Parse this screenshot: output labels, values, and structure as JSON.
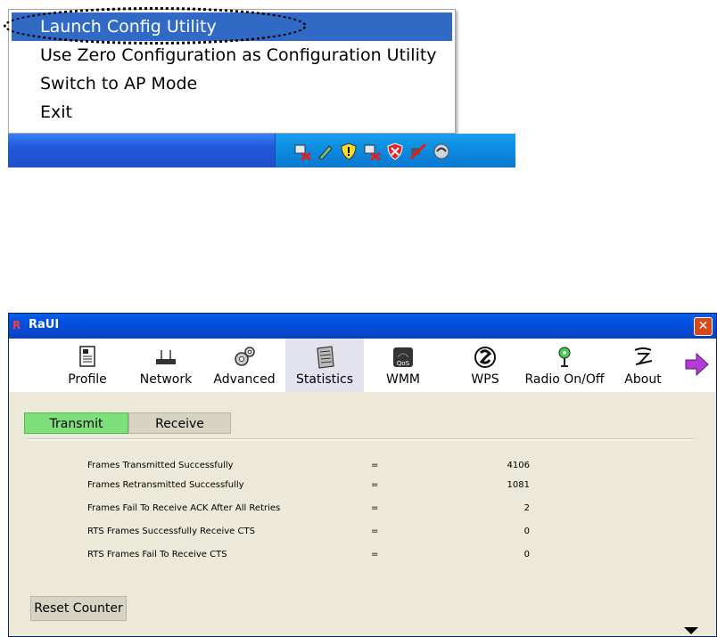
{
  "context_menu": {
    "items": [
      {
        "label": "Launch Config Utility"
      },
      {
        "label": "Use Zero Configuration as Configuration Utility"
      },
      {
        "label": "Switch to AP Mode"
      },
      {
        "label": "Exit"
      }
    ]
  },
  "tray": {
    "icons": [
      "network-disconnected-icon",
      "pen-icon",
      "security-shield-icon",
      "network-disconnected-icon",
      "alert-shield-icon",
      "wireless-disconnected-icon",
      "ralink-icon"
    ]
  },
  "window": {
    "title": "RaUI",
    "close_glyph": "✕",
    "toolbar": {
      "items": [
        {
          "label": "Profile",
          "icon": "profile-icon"
        },
        {
          "label": "Network",
          "icon": "router-icon"
        },
        {
          "label": "Advanced",
          "icon": "gears-icon"
        },
        {
          "label": "Statistics",
          "icon": "calculator-icon"
        },
        {
          "label": "WMM",
          "icon": "qos-icon"
        },
        {
          "label": "WPS",
          "icon": "wps-icon"
        },
        {
          "label": "Radio On/Off",
          "icon": "radio-icon"
        },
        {
          "label": "About",
          "icon": "about-icon"
        }
      ],
      "next_icon": "arrow-right-icon"
    },
    "tabs": {
      "transmit": "Transmit",
      "receive": "Receive"
    },
    "stats": [
      {
        "name": "Frames Transmitted Successfully",
        "eq": "=",
        "value": "4106"
      },
      {
        "name": "Frames Retransmitted Successfully",
        "eq": "=",
        "value": "1081"
      },
      {
        "name": "Frames Fail To Receive ACK After All Retries",
        "eq": "=",
        "value": "2"
      },
      {
        "name": "RTS Frames Successfully Receive CTS",
        "eq": "=",
        "value": "0"
      },
      {
        "name": "RTS Frames Fail To Receive CTS",
        "eq": "=",
        "value": "0"
      }
    ],
    "reset_label": "Reset Counter",
    "colors": {
      "title_bar": "#0a49d4",
      "active_tab": "#7de07a",
      "menu_highlight": "#316ac5"
    }
  }
}
